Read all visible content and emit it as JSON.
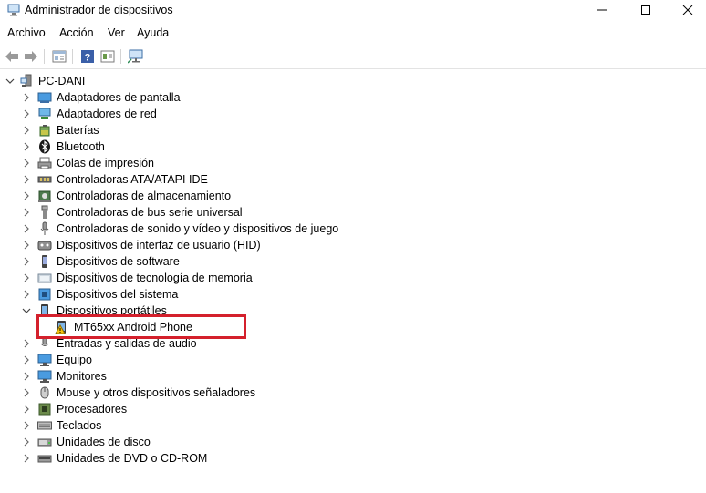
{
  "window": {
    "title": "Administrador de dispositivos",
    "icon": "device-manager-icon"
  },
  "menu": [
    "Archivo",
    "Acción",
    "Ver",
    "Ayuda"
  ],
  "toolbar": {
    "buttons": [
      "back-arrow-icon",
      "forward-arrow-icon",
      "properties-icon",
      "help-icon",
      "view-icon",
      "monitor-scan-icon"
    ]
  },
  "tree": {
    "root": "PC-DANI",
    "categories": [
      {
        "label": "Adaptadores de pantalla",
        "icon": "display-adapter-icon"
      },
      {
        "label": "Adaptadores de red",
        "icon": "network-adapter-icon"
      },
      {
        "label": "Baterías",
        "icon": "battery-icon"
      },
      {
        "label": "Bluetooth",
        "icon": "bluetooth-icon"
      },
      {
        "label": "Colas de impresión",
        "icon": "printer-icon"
      },
      {
        "label": "Controladoras ATA/ATAPI IDE",
        "icon": "ide-controller-icon"
      },
      {
        "label": "Controladoras de almacenamiento",
        "icon": "storage-controller-icon"
      },
      {
        "label": "Controladoras de bus serie universal",
        "icon": "usb-icon"
      },
      {
        "label": "Controladoras de sonido y vídeo y dispositivos de juego",
        "icon": "sound-icon"
      },
      {
        "label": "Dispositivos de interfaz de usuario (HID)",
        "icon": "hid-icon"
      },
      {
        "label": "Dispositivos de software",
        "icon": "software-device-icon"
      },
      {
        "label": "Dispositivos de tecnología de memoria",
        "icon": "memory-device-icon"
      },
      {
        "label": "Dispositivos del sistema",
        "icon": "system-device-icon"
      },
      {
        "label": "Dispositivos portátiles",
        "icon": "portable-device-icon",
        "expanded": true
      },
      {
        "label": "MT65xx Android Phone",
        "icon": "warning-icon",
        "child": true,
        "highlighted": true
      },
      {
        "label": "Entradas y salidas de audio",
        "icon": "audio-io-icon"
      },
      {
        "label": "Equipo",
        "icon": "computer-icon"
      },
      {
        "label": "Monitores",
        "icon": "monitor-icon"
      },
      {
        "label": "Mouse y otros dispositivos señaladores",
        "icon": "mouse-icon"
      },
      {
        "label": "Procesadores",
        "icon": "processor-icon"
      },
      {
        "label": "Teclados",
        "icon": "keyboard-icon"
      },
      {
        "label": "Unidades de disco",
        "icon": "disk-drive-icon"
      },
      {
        "label": "Unidades de DVD o CD-ROM",
        "icon": "dvd-drive-icon"
      }
    ]
  },
  "colors": {
    "highlight_border": "#d4202c",
    "warning": "#f4c20d"
  }
}
